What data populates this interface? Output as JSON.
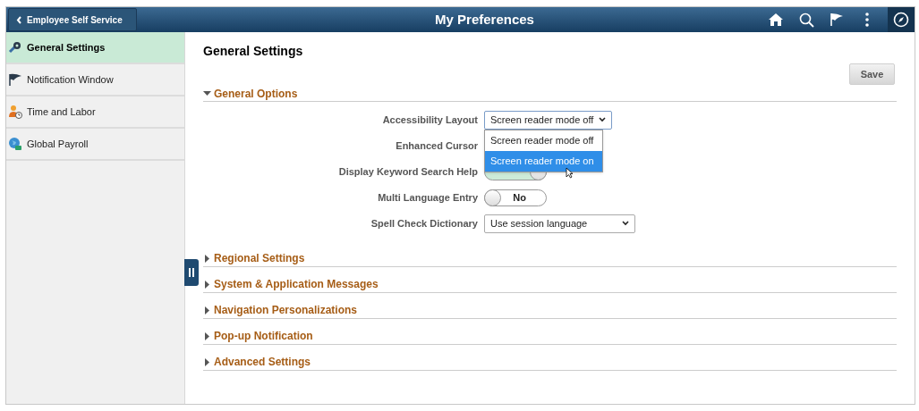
{
  "header": {
    "back_button": "Employee Self Service",
    "title": "My Preferences"
  },
  "sidebar": {
    "items": [
      {
        "label": "General Settings",
        "selected": true
      },
      {
        "label": "Notification Window",
        "selected": false
      },
      {
        "label": "Time and Labor",
        "selected": false
      },
      {
        "label": "Global Payroll",
        "selected": false
      }
    ]
  },
  "content": {
    "title": "General Settings",
    "save_button": "Save",
    "general_options": {
      "label": "General Options",
      "expanded": true,
      "fields": [
        {
          "kind": "select",
          "label": "Accessibility Layout",
          "value": "Screen reader mode off",
          "open": true,
          "options": [
            {
              "label": "Screen reader mode off",
              "highlighted": false
            },
            {
              "label": "Screen reader mode on",
              "highlighted": true
            }
          ]
        },
        {
          "kind": "hidden",
          "label": "Enhanced Cursor"
        },
        {
          "kind": "toggle",
          "label": "Display Keyword Search Help",
          "on": true
        },
        {
          "kind": "toggle",
          "label": "Multi Language Entry",
          "value": "No",
          "on": false
        },
        {
          "kind": "select",
          "label": "Spell Check Dictionary",
          "value": "Use session language",
          "open": false
        }
      ]
    },
    "sections": [
      {
        "label": "Regional Settings",
        "expanded": false
      },
      {
        "label": "System & Application Messages",
        "expanded": false
      },
      {
        "label": "Navigation Personalizations",
        "expanded": false
      },
      {
        "label": "Pop-up Notification",
        "expanded": false
      },
      {
        "label": "Advanced Settings",
        "expanded": false
      }
    ]
  }
}
